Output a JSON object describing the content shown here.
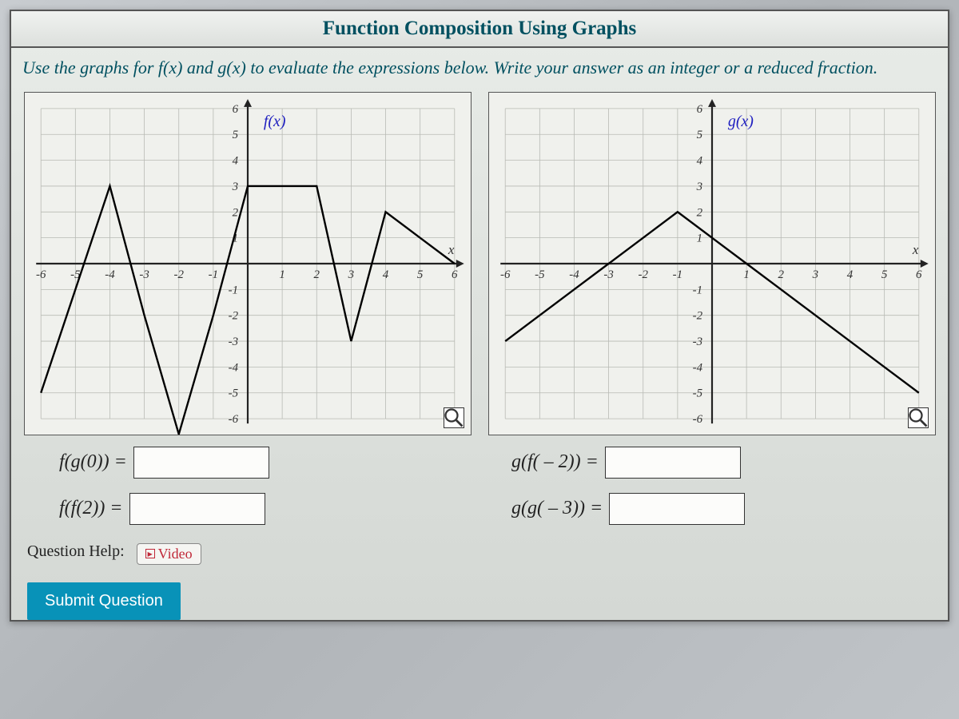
{
  "title": "Function Composition Using Graphs",
  "instructions_prefix": "Use the graphs for ",
  "fn_f": "f(x)",
  "instructions_mid": " and ",
  "fn_g": "g(x)",
  "instructions_suffix": " to evaluate the expressions below. Write your answer as an integer or a reduced fraction.",
  "q1_label": "f(g(0)) =",
  "q2_label": "f(f(2)) =",
  "q3_label": "g(f( – 2)) =",
  "q4_label": "g(g( – 3)) =",
  "q1_value": "",
  "q2_value": "",
  "q3_value": "",
  "q4_value": "",
  "help_prefix": "Question Help:",
  "video_label": "Video",
  "submit_label": "Submit Question",
  "chart_data": [
    {
      "type": "line",
      "title": "f(x)",
      "xlabel": "x",
      "ylabel": "",
      "xlim": [
        -6,
        6
      ],
      "ylim": [
        -6,
        6
      ],
      "x": [
        -6,
        -5,
        -4,
        -3,
        -2,
        -1,
        0,
        1,
        2,
        3,
        4,
        5,
        6
      ],
      "y": [
        -5,
        -1,
        3,
        -2,
        -7,
        -2,
        3,
        3,
        3,
        -3,
        2,
        1,
        0
      ],
      "grid": true,
      "legend": "f(x)",
      "label_color": "#2020c0",
      "line_color": "#000000"
    },
    {
      "type": "line",
      "title": "g(x)",
      "xlabel": "x",
      "ylabel": "",
      "xlim": [
        -6,
        6
      ],
      "ylim": [
        -6,
        6
      ],
      "x": [
        -6,
        -5,
        -4,
        -3,
        -2,
        -1,
        0,
        1,
        2,
        3,
        4,
        5,
        6
      ],
      "y": [
        -3,
        -2,
        -1,
        0,
        1,
        2,
        1,
        0,
        -1,
        -2,
        -3,
        -4,
        -5
      ],
      "grid": true,
      "legend": "g(x)",
      "label_color": "#2020c0",
      "line_color": "#000000"
    }
  ]
}
